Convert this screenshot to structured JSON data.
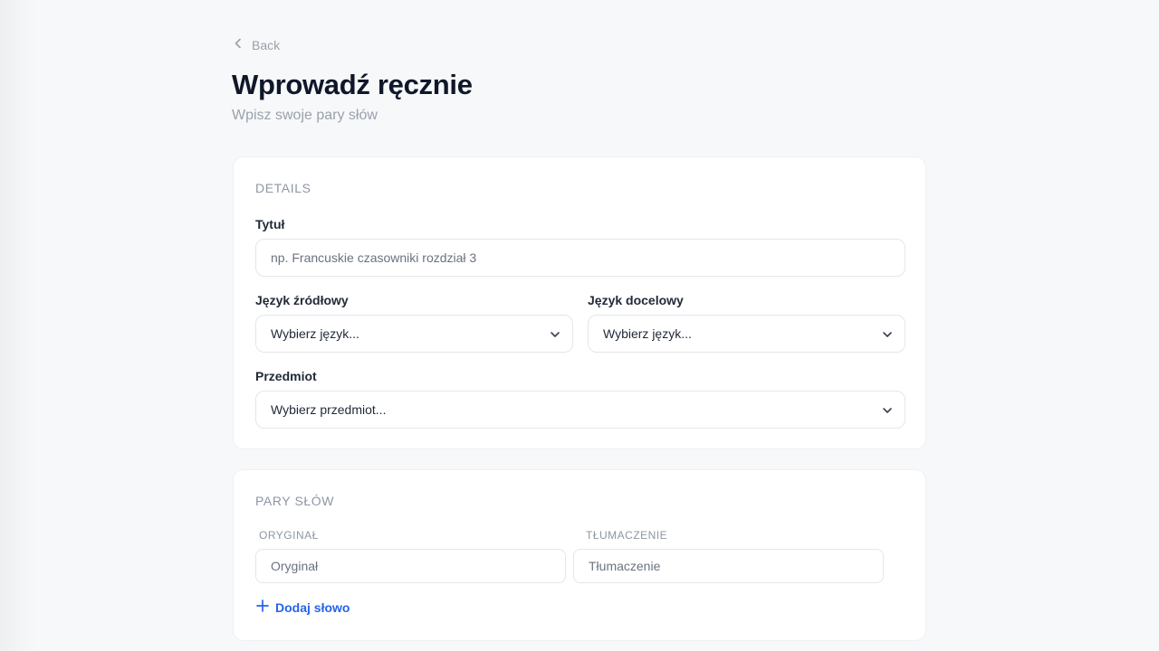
{
  "nav": {
    "back_label": "Back"
  },
  "header": {
    "title": "Wprowadź ręcznie",
    "subtitle": "Wpisz swoje pary słów"
  },
  "details": {
    "section_label": "DETAILS",
    "title_field": {
      "label": "Tytuł",
      "placeholder": "np. Francuskie czasowniki rozdział 3"
    },
    "source_language": {
      "label": "Język źródłowy",
      "value": "Wybierz język..."
    },
    "target_language": {
      "label": "Język docelowy",
      "value": "Wybierz język..."
    },
    "subject": {
      "label": "Przedmiot",
      "value": "Wybierz przedmiot..."
    }
  },
  "pairs": {
    "section_label": "PARY SŁÓW",
    "original_header": "ORYGINAŁ",
    "translation_header": "TŁUMACZENIE",
    "original_placeholder": "Oryginał",
    "translation_placeholder": "Tłumaczenie",
    "add_word_label": "Dodaj słowo"
  },
  "colors": {
    "accent": "#2563eb",
    "background": "#f7f8fa",
    "card": "#ffffff",
    "muted_text": "#9aa1ac"
  },
  "icons": {
    "back": "chevron-left-icon",
    "select": "chevron-down-icon",
    "add": "plus-icon"
  }
}
